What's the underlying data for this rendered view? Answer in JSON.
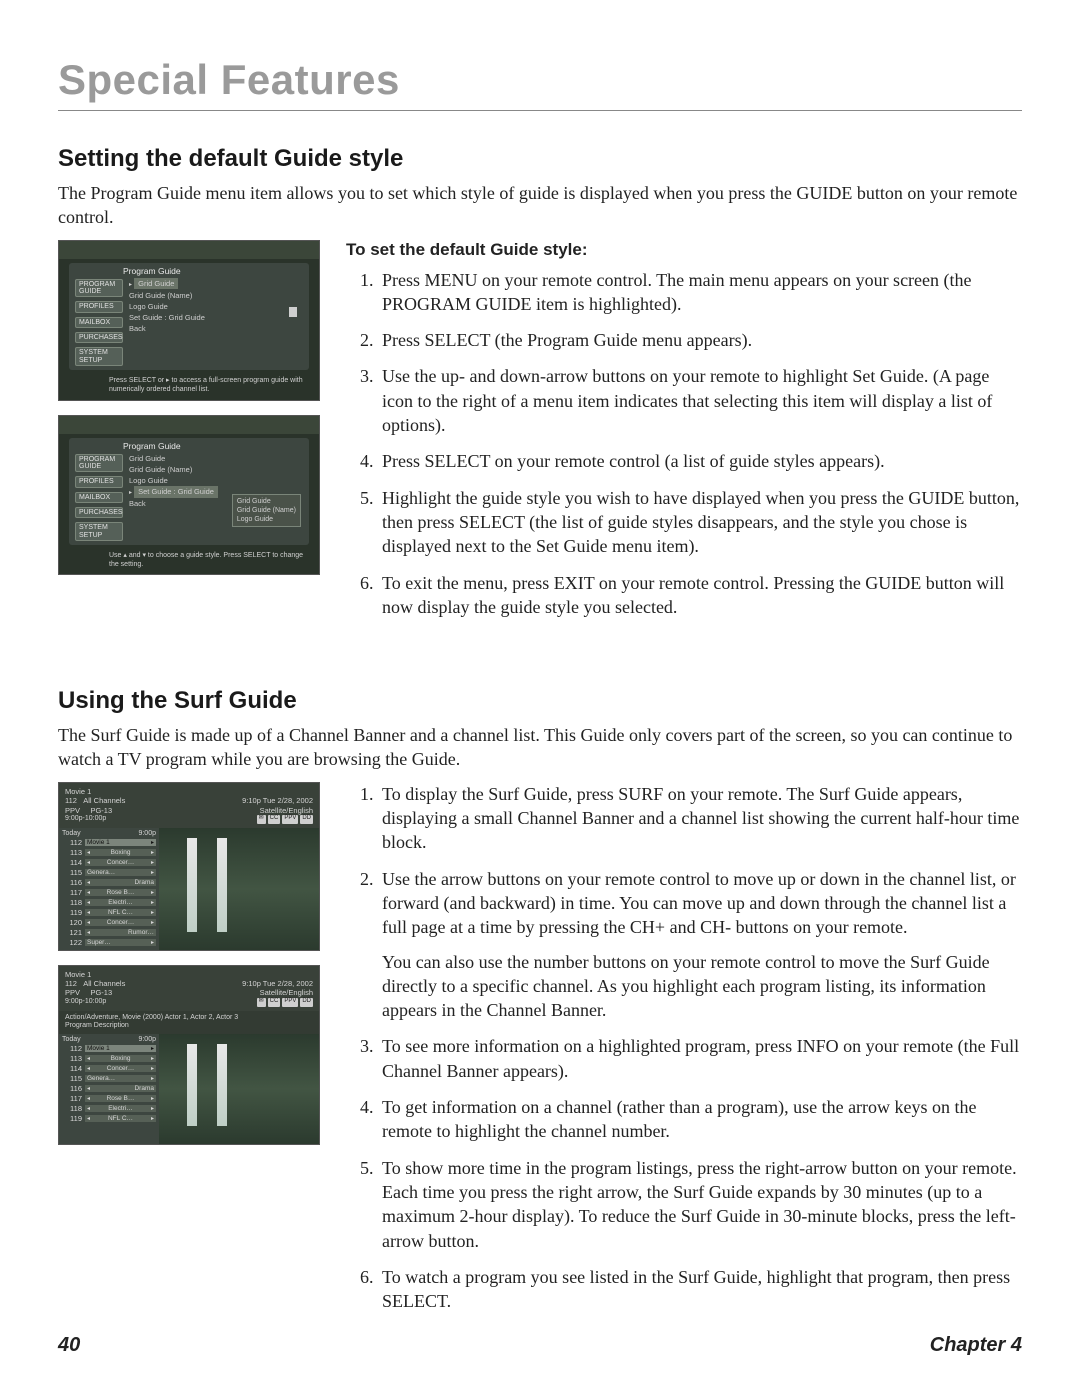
{
  "chapter_title": "Special Features",
  "section1": {
    "heading": "Setting the default Guide style",
    "intro": "The Program Guide menu item allows you to set which style of guide is displayed when you press the GUIDE button on your remote control.",
    "sub_heading": "To set the default Guide style:",
    "steps": [
      "Press MENU on your remote control. The main menu appears on your screen (the PROGRAM GUIDE item is highlighted).",
      "Press SELECT (the Program Guide menu appears).",
      "Use the up- and down-arrow buttons on your remote to highlight Set Guide. (A page icon to the right of a menu item indicates that selecting this item will display a list of options).",
      "Press SELECT on your remote control (a list of guide styles appears).",
      "Highlight the guide style you wish to have displayed when you press the GUIDE button, then press SELECT (the list of guide styles disappears, and the style you chose is displayed next to the Set Guide menu item).",
      "To exit the menu, press EXIT on your remote control. Pressing the GUIDE button will now display the guide style you selected."
    ],
    "screenshot1": {
      "panel_title": "Program Guide",
      "tabs": [
        "PROGRAM GUIDE",
        "PROFILES",
        "MAILBOX",
        "PURCHASES",
        "SYSTEM SETUP"
      ],
      "items": [
        "Grid Guide",
        "Grid Guide (Name)",
        "Logo Guide",
        "Set Guide : Grid Guide",
        "Back"
      ],
      "hint": "Press SELECT or ▸ to access a full-screen program guide with numerically ordered channel list."
    },
    "screenshot2": {
      "panel_title": "Program Guide",
      "tabs": [
        "PROGRAM GUIDE",
        "PROFILES",
        "MAILBOX",
        "PURCHASES",
        "SYSTEM SETUP"
      ],
      "items": [
        "Grid Guide",
        "Grid Guide (Name)",
        "Logo Guide",
        "Set Guide : Grid Guide",
        "Back"
      ],
      "popup": [
        "Grid Guide",
        "Grid Guide (Name)",
        "Logo Guide"
      ],
      "hint": "Use ▴ and ▾ to choose a guide style. Press SELECT to change the setting."
    }
  },
  "section2": {
    "heading": "Using the Surf Guide",
    "intro": "The Surf Guide is made up of a Channel Banner and a channel list. This Guide only covers part of the screen, so you can continue to watch a TV program while you are browsing the Guide.",
    "steps": [
      "To display the Surf Guide, press SURF on your remote. The Surf Guide appears, displaying a small Channel Banner and a channel list showing the current half-hour time block.",
      "Use the arrow buttons on your remote control to move up or down in the channel list, or forward (and backward) in time. You can move up and down through the channel list a full page at a time by pressing the CH+ and CH- buttons on your remote.",
      "To see more information on a highlighted program, press INFO on your remote (the Full Channel Banner appears).",
      "To get information on a channel (rather than a program), use the arrow keys on the remote to highlight the channel number.",
      "To show more time in the program listings, press the right-arrow button on your remote. Each time you press the right arrow, the Surf Guide expands by 30 minutes (up to a maximum 2-hour display). To reduce the Surf Guide in 30-minute blocks, press the left-arrow button.",
      "To watch a program you see listed in the Surf Guide, highlight that program, then press SELECT."
    ],
    "step2_extra": "You can also use the number buttons on your remote control to move the Surf Guide directly to a specific channel. As you highlight each program listing, its information appears in the Channel Banner.",
    "surf1": {
      "title": "Movie 1",
      "ch": "112",
      "cat": "PPV",
      "all": "All Channels",
      "rating": "PG-13",
      "time": "9:00p-10:00p",
      "clock": "9:10p Tue 2/28, 2002",
      "lang": "Satellite/English",
      "hdr_today": "Today",
      "hdr_time": "9:00p",
      "rows": [
        {
          "ch": "112",
          "prog": "Movie 1",
          "sel": true
        },
        {
          "ch": "113",
          "prog": "Boxing"
        },
        {
          "ch": "114",
          "prog": "Concer…"
        },
        {
          "ch": "115",
          "prog": "Genera…"
        },
        {
          "ch": "116",
          "prog": "Drama"
        },
        {
          "ch": "117",
          "prog": "Rose B…"
        },
        {
          "ch": "118",
          "prog": "Electri…"
        },
        {
          "ch": "119",
          "prog": "NFL C…"
        },
        {
          "ch": "120",
          "prog": "Concer…"
        },
        {
          "ch": "121",
          "prog": "Rumor…"
        },
        {
          "ch": "122",
          "prog": "Super…"
        }
      ]
    },
    "surf2": {
      "title": "Movie 1",
      "ch": "112",
      "cat": "PPV",
      "all": "All Channels",
      "rating": "PG-13",
      "time": "9:00p-10:00p",
      "clock": "9:10p Tue 2/28, 2002",
      "lang": "Satellite/English",
      "desc1": "Action/Adventure, Movie (2000) Actor 1, Actor 2, Actor 3",
      "desc2": "Program Description",
      "hdr_today": "Today",
      "hdr_time": "9:00p",
      "rows": [
        {
          "ch": "112",
          "prog": "Movie 1",
          "sel": true
        },
        {
          "ch": "113",
          "prog": "Boxing"
        },
        {
          "ch": "114",
          "prog": "Concer…"
        },
        {
          "ch": "115",
          "prog": "Genera…"
        },
        {
          "ch": "116",
          "prog": "Drama"
        },
        {
          "ch": "117",
          "prog": "Rose B…"
        },
        {
          "ch": "118",
          "prog": "Electri…"
        },
        {
          "ch": "119",
          "prog": "NFL C…"
        }
      ]
    }
  },
  "footer": {
    "page": "40",
    "chapter": "Chapter 4"
  }
}
